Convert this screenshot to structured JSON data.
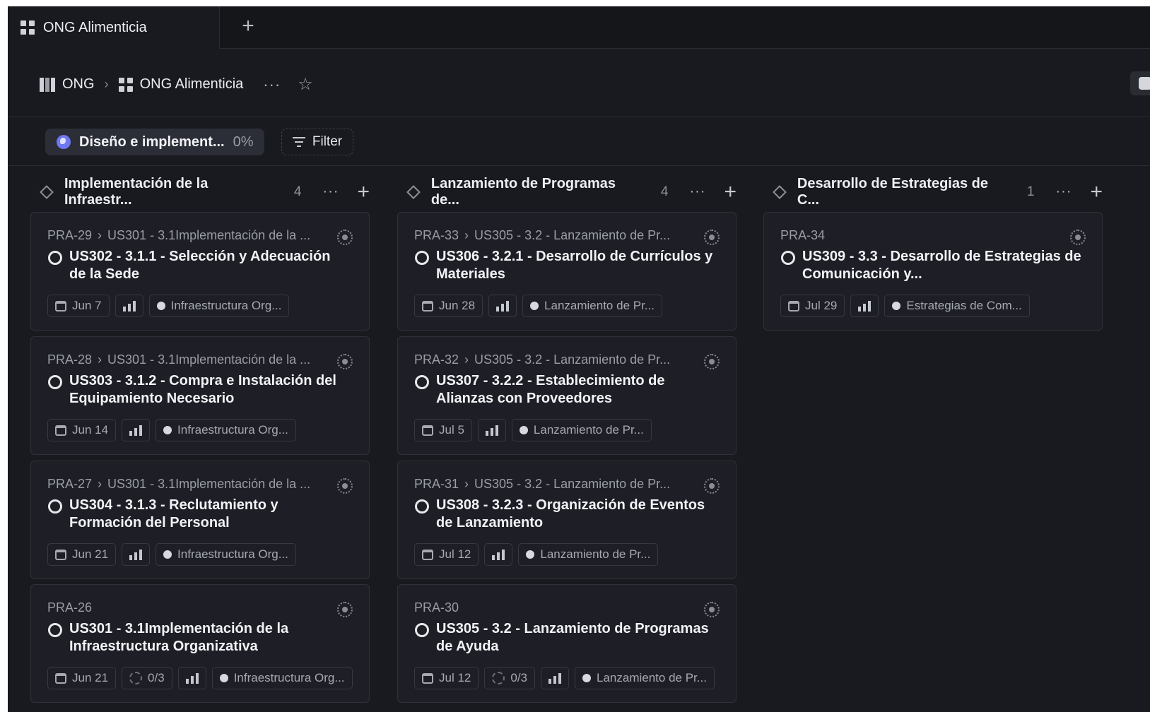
{
  "tab": {
    "label": "ONG Alimenticia",
    "new_tab_label": "+"
  },
  "breadcrumb": {
    "root": "ONG",
    "separator": "›",
    "current": "ONG Alimenticia",
    "more": "···",
    "favorite_icon": "star-icon"
  },
  "filterbar": {
    "chip_label": "Diseño e implement...",
    "chip_progress": "0%",
    "filter_label": "Filter"
  },
  "columns": [
    {
      "title": "Implementación de la Infraestr...",
      "count": "4",
      "cards": [
        {
          "id": "PRA-29",
          "parent": "US301 - 3.1Implementación de la ...",
          "title": "US302 - 3.1.1 - Selección y Adecuación de la Sede",
          "date": "Jun 7",
          "subtasks": "",
          "label": "Infraestructura Org..."
        },
        {
          "id": "PRA-28",
          "parent": "US301 - 3.1Implementación de la ...",
          "title": "US303 - 3.1.2 - Compra e Instalación del Equipamiento Necesario",
          "date": "Jun 14",
          "subtasks": "",
          "label": "Infraestructura Org..."
        },
        {
          "id": "PRA-27",
          "parent": "US301 - 3.1Implementación de la ...",
          "title": "US304 - 3.1.3 - Reclutamiento y Formación del Personal",
          "date": "Jun 21",
          "subtasks": "",
          "label": "Infraestructura Org..."
        },
        {
          "id": "PRA-26",
          "parent": "",
          "title": "US301 - 3.1Implementación de la Infraestructura Organizativa",
          "date": "Jun 21",
          "subtasks": "0/3",
          "label": "Infraestructura Org..."
        }
      ]
    },
    {
      "title": "Lanzamiento de Programas de...",
      "count": "4",
      "cards": [
        {
          "id": "PRA-33",
          "parent": "US305 - 3.2 - Lanzamiento de Pr...",
          "title": "US306 - 3.2.1 - Desarrollo de Currículos y Materiales",
          "date": "Jun 28",
          "subtasks": "",
          "label": "Lanzamiento de Pr..."
        },
        {
          "id": "PRA-32",
          "parent": "US305 - 3.2 - Lanzamiento de Pr...",
          "title": "US307 - 3.2.2 - Establecimiento de Alianzas con Proveedores",
          "date": "Jul 5",
          "subtasks": "",
          "label": "Lanzamiento de Pr..."
        },
        {
          "id": "PRA-31",
          "parent": "US305 - 3.2 - Lanzamiento de Pr...",
          "title": "US308 - 3.2.3 - Organización de Eventos de Lanzamiento",
          "date": "Jul 12",
          "subtasks": "",
          "label": "Lanzamiento de Pr..."
        },
        {
          "id": "PRA-30",
          "parent": "",
          "title": "US305 - 3.2 - Lanzamiento de Programas de Ayuda",
          "date": "Jul 12",
          "subtasks": "0/3",
          "label": "Lanzamiento de Pr..."
        }
      ]
    },
    {
      "title": "Desarrollo de Estrategias de C...",
      "count": "1",
      "cards": [
        {
          "id": "PRA-34",
          "parent": "",
          "title": "US309 - 3.3 - Desarrollo de Estrategias de Comunicación y...",
          "date": "Jul 29",
          "subtasks": "",
          "label": "Estrategias de Com..."
        }
      ]
    }
  ]
}
